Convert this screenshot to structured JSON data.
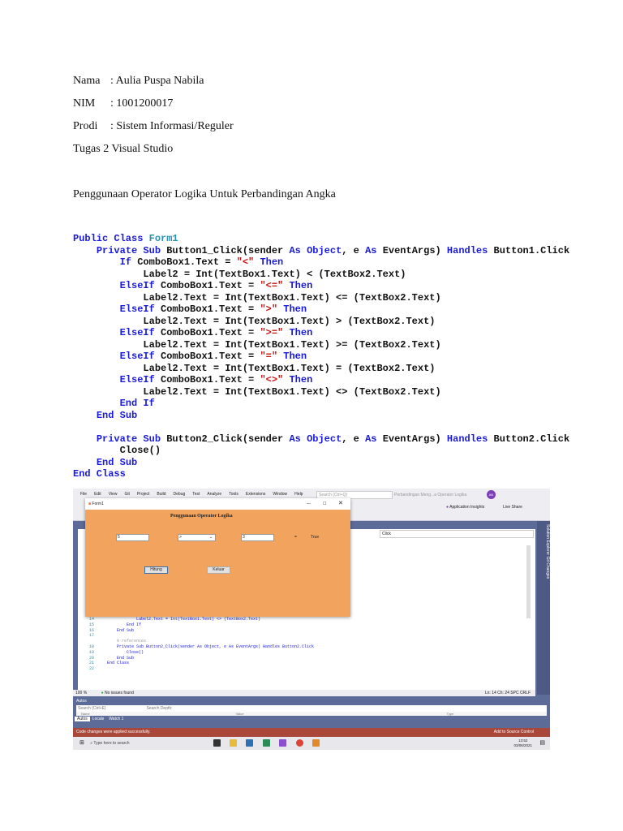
{
  "identity": {
    "nama_label": "Nama",
    "nama_value": ": Aulia Puspa Nabila",
    "nim_label": "NIM",
    "nim_value": ": 1001200017",
    "prodi_label": "Prodi",
    "prodi_value": ": Sistem Informasi/Reguler",
    "assignment": "Tugas 2 Visual Studio"
  },
  "section_title": "Penggunaan Operator Logika Untuk Perbandingan Angka",
  "code": [
    [
      [
        "kw",
        "Public Class "
      ],
      [
        "cls",
        "Form1"
      ]
    ],
    [
      [
        "p",
        "    "
      ],
      [
        "kw",
        "Private Sub "
      ],
      [
        "p",
        "Button1_Click(sender "
      ],
      [
        "kw",
        "As Object"
      ],
      [
        "p",
        ", e "
      ],
      [
        "kw",
        "As "
      ],
      [
        "p",
        "EventArgs) "
      ],
      [
        "kw",
        "Handles "
      ],
      [
        "p",
        "Button1.Click"
      ]
    ],
    [
      [
        "p",
        "        "
      ],
      [
        "kw",
        "If "
      ],
      [
        "p",
        "ComboBox1.Text = "
      ],
      [
        "str",
        "\"<\""
      ],
      [
        "kw",
        " Then"
      ]
    ],
    [
      [
        "p",
        "            Label2 = Int(TextBox1.Text) < (TextBox2.Text)"
      ]
    ],
    [
      [
        "p",
        "        "
      ],
      [
        "kw",
        "ElseIf "
      ],
      [
        "p",
        "ComboBox1.Text = "
      ],
      [
        "str",
        "\"<=\""
      ],
      [
        "kw",
        " Then"
      ]
    ],
    [
      [
        "p",
        "            Label2.Text = Int(TextBox1.Text) <= (TextBox2.Text)"
      ]
    ],
    [
      [
        "p",
        "        "
      ],
      [
        "kw",
        "ElseIf "
      ],
      [
        "p",
        "ComboBox1.Text = "
      ],
      [
        "str",
        "\">\""
      ],
      [
        "kw",
        " Then"
      ]
    ],
    [
      [
        "p",
        "            Label2.Text = Int(TextBox1.Text) > (TextBox2.Text)"
      ]
    ],
    [
      [
        "p",
        "        "
      ],
      [
        "kw",
        "ElseIf "
      ],
      [
        "p",
        "ComboBox1.Text = "
      ],
      [
        "str",
        "\">=\""
      ],
      [
        "kw",
        " Then"
      ]
    ],
    [
      [
        "p",
        "            Label2.Text = Int(TextBox1.Text) >= (TextBox2.Text)"
      ]
    ],
    [
      [
        "p",
        "        "
      ],
      [
        "kw",
        "ElseIf "
      ],
      [
        "p",
        "ComboBox1.Text = "
      ],
      [
        "str",
        "\"=\""
      ],
      [
        "kw",
        " Then"
      ]
    ],
    [
      [
        "p",
        "            Label2.Text = Int(TextBox1.Text) = (TextBox2.Text)"
      ]
    ],
    [
      [
        "p",
        "        "
      ],
      [
        "kw",
        "ElseIf "
      ],
      [
        "p",
        "ComboBox1.Text = "
      ],
      [
        "str",
        "\"<>\""
      ],
      [
        "kw",
        " Then"
      ]
    ],
    [
      [
        "p",
        "            Label2.Text = Int(TextBox1.Text) <> (TextBox2.Text)"
      ]
    ],
    [
      [
        "p",
        "        "
      ],
      [
        "kw",
        "End If"
      ]
    ],
    [
      [
        "p",
        "    "
      ],
      [
        "kw",
        "End Sub"
      ]
    ],
    [
      [
        "p",
        ""
      ]
    ],
    [
      [
        "p",
        "    "
      ],
      [
        "kw",
        "Private Sub "
      ],
      [
        "p",
        "Button2_Click(sender "
      ],
      [
        "kw",
        "As Object"
      ],
      [
        "p",
        ", e "
      ],
      [
        "kw",
        "As "
      ],
      [
        "p",
        "EventArgs) "
      ],
      [
        "kw",
        "Handles "
      ],
      [
        "p",
        "Button2.Click"
      ]
    ],
    [
      [
        "p",
        "        Close()"
      ]
    ],
    [
      [
        "p",
        "    "
      ],
      [
        "kw",
        "End Sub"
      ]
    ],
    [
      [
        "kw",
        "End Class"
      ]
    ]
  ],
  "screenshot": {
    "menu": [
      "File",
      "Edit",
      "View",
      "Git",
      "Project",
      "Build",
      "Debug",
      "Test",
      "Analyze",
      "Tools",
      "Extensions",
      "Window",
      "Help"
    ],
    "search_placeholder": "Search (Ctrl+Q)",
    "solution_name": "Perbandingan Meng...a Operator Logika",
    "avatar": "AN",
    "app_insights": "Application Insights",
    "live_share": "Live Share",
    "member_dropdown": "Click",
    "side_tabs": "Solution Explorer   Git Changes",
    "form": {
      "title": "Form1",
      "heading": "Penggunaan Operator Logika",
      "textbox1": "5",
      "combo": ">",
      "textbox2": "3",
      "equals": "=",
      "result": "True",
      "button1": "Hitung",
      "button2": "Keluar"
    },
    "editor_lines": [
      [
        "14",
        "            Label2.Text = Int(TextBox1.Text) <> (TextBox2.Text)"
      ],
      [
        "15",
        "        End If"
      ],
      [
        "16",
        "    End Sub"
      ],
      [
        "17",
        ""
      ],
      [
        "",
        "    0 references"
      ],
      [
        "18",
        "    Private Sub Button2_Click(sender As Object, e As EventArgs) Handles Button2.Click"
      ],
      [
        "19",
        "        Close()"
      ],
      [
        "20",
        "    End Sub"
      ],
      [
        "21",
        "End Class"
      ],
      [
        "22",
        ""
      ]
    ],
    "zoom": "100 %",
    "issues": "No issues found",
    "cursor": "Ln: 14   Ch: 24   SPC   CRLF",
    "autos_title": "Autos",
    "autos_search": "Search (Ctrl+E)",
    "search_depth": "Search Depth:",
    "col_name": "Name",
    "col_value": "Value",
    "col_type": "Type",
    "autos_tabs": [
      "Autos",
      "Locals",
      "Watch 1"
    ],
    "notification": "Code changes were applied successfully.",
    "source_control": "Add to Source Control",
    "taskbar_search": "Type here to search",
    "time": "13:52",
    "date": "03/06/2021"
  }
}
